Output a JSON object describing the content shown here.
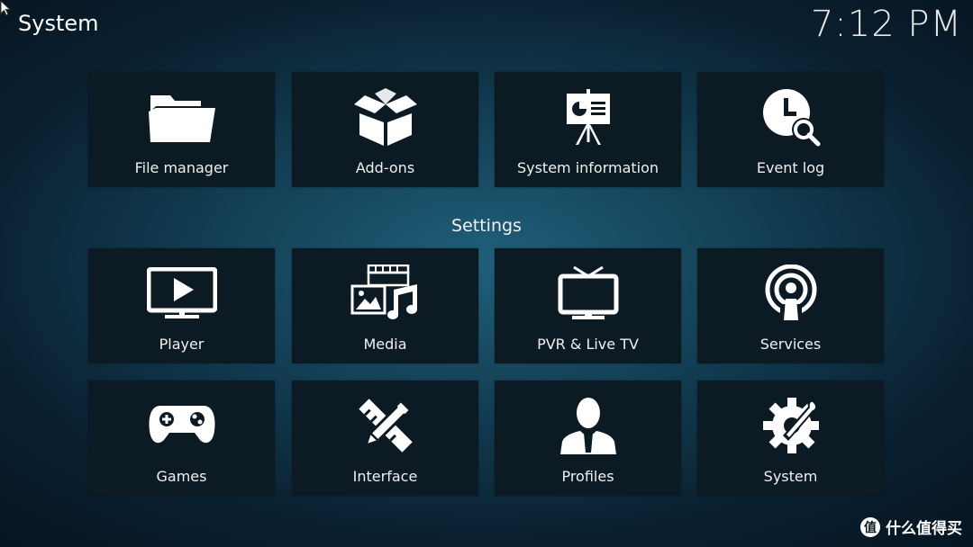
{
  "header": {
    "title": "System",
    "clock": "7:12 PM"
  },
  "top_tiles": [
    {
      "label": "File manager",
      "icon": "folder-icon"
    },
    {
      "label": "Add-ons",
      "icon": "open-box-icon"
    },
    {
      "label": "System information",
      "icon": "presentation-easel-icon"
    },
    {
      "label": "Event log",
      "icon": "clock-search-icon"
    }
  ],
  "settings_heading": "Settings",
  "settings_tiles": [
    {
      "label": "Player",
      "icon": "monitor-play-icon"
    },
    {
      "label": "Media",
      "icon": "media-collage-icon"
    },
    {
      "label": "PVR & Live TV",
      "icon": "tv-antenna-icon"
    },
    {
      "label": "Services",
      "icon": "broadcast-icon"
    },
    {
      "label": "Games",
      "icon": "gamepad-icon"
    },
    {
      "label": "Interface",
      "icon": "pencil-ruler-icon"
    },
    {
      "label": "Profiles",
      "icon": "user-silhouette-icon"
    },
    {
      "label": "System",
      "icon": "gear-wrench-icon"
    }
  ],
  "watermark": {
    "text": "什么值得买",
    "logo": "值"
  },
  "colors": {
    "tile_bg": "#0c1a24",
    "text": "#ffffff"
  }
}
